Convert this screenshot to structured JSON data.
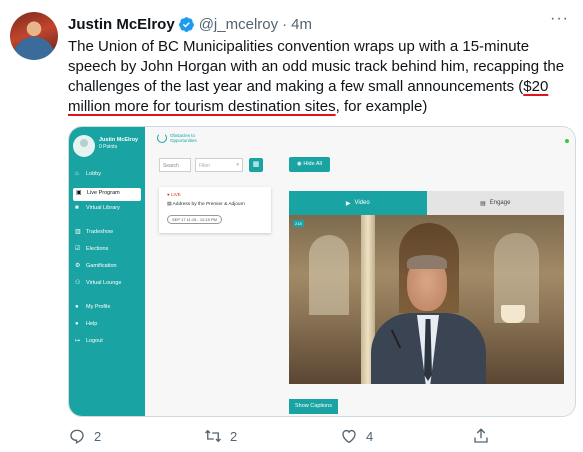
{
  "tweet": {
    "author_name": "Justin McElroy",
    "handle": "@j_mcelroy",
    "separator": "·",
    "time": "4m",
    "more": "···",
    "text_before": "The Union of BC Municipalities convention wraps up with a 15-minute speech by John Horgan with an odd music track behind him, recapping the challenges of the last year and making a few small announcements (",
    "text_underlined": "$20 million more for tourism destination sites",
    "text_after": ", for example)"
  },
  "media": {
    "sidebar": {
      "user_name": "Justin McElroy",
      "user_points": "0 Points",
      "items": [
        {
          "icon": "home-icon",
          "label": "Lobby"
        },
        {
          "icon": "tv-icon",
          "label": "Live Program"
        },
        {
          "icon": "camera-icon",
          "label": "Virtual Library"
        },
        {
          "icon": "book-icon",
          "label": "Tradeshow"
        },
        {
          "icon": "ballot-icon",
          "label": "Elections"
        },
        {
          "icon": "gear-icon",
          "label": "Gamification"
        },
        {
          "icon": "users-icon",
          "label": "Virtual Lounge"
        },
        {
          "icon": "person-icon",
          "label": "My Profile"
        },
        {
          "icon": "help-icon",
          "label": "Help"
        },
        {
          "icon": "logout-icon",
          "label": "Logout"
        }
      ],
      "active_index": 1
    },
    "logo_text": "Obstacles to Opportunities",
    "search_placeholder": "Search",
    "filter_placeholder": "Filter",
    "hide_all_label": "Hide All",
    "session": {
      "live_label": "LIVE",
      "title": "Address by the Premier & Adjourn",
      "time": "SEP 17 11:15 - 12:15 PM"
    },
    "tab_video": "Video",
    "tab_engage": "Engage",
    "video_badge": "218",
    "show_captions_label": "Show Captions",
    "accent_color": "#1aa3a3"
  },
  "actions": {
    "replies": "2",
    "retweets": "2",
    "likes": "4"
  }
}
